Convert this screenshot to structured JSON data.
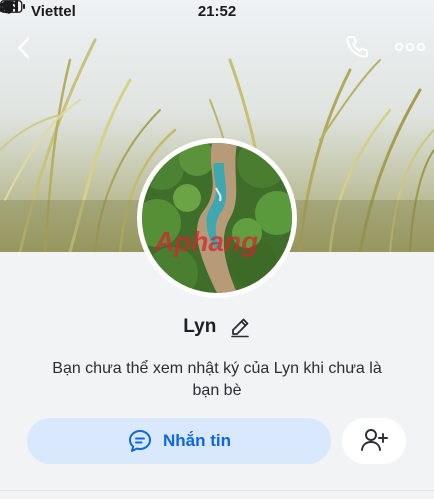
{
  "status_bar": {
    "carrier": "Viettel",
    "time": "21:52",
    "icons": [
      "signal-icon",
      "wifi-icon",
      "rotation-lock-icon",
      "battery-icon"
    ]
  },
  "header": {
    "icons": {
      "back": "chevron-left-icon",
      "call": "phone-icon",
      "more": "ellipsis-icon"
    }
  },
  "profile": {
    "name": "Lyn",
    "avatar_watermark": "Aphang"
  },
  "notice": {
    "line1": "Bạn chưa thể xem nhật ký của Lyn khi chưa là",
    "line2": "bạn bè"
  },
  "actions": {
    "message_label": "Nhắn tin",
    "message_icon": "chat-bubble-icon",
    "add_friend_icon": "add-user-icon",
    "accent_color": "#0d67e6",
    "message_bg": "#d9e8fd"
  }
}
